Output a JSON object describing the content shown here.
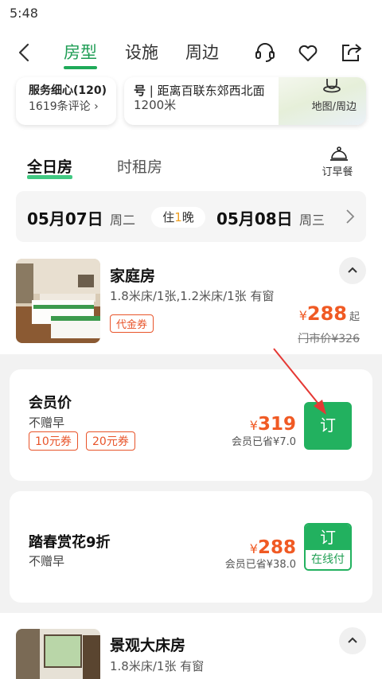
{
  "status": {
    "time": "5:48"
  },
  "nav": {
    "tabs": [
      {
        "label": "房型",
        "active": true
      },
      {
        "label": "设施",
        "active": false
      },
      {
        "label": "周边",
        "active": false
      }
    ],
    "icons": [
      "back-icon",
      "customer-service-icon",
      "heart-icon",
      "share-icon"
    ]
  },
  "info": {
    "rating_label": "服务细心(120)",
    "reviews": "1619条评论",
    "location_line1_bold": "号",
    "location_line1": "距离百联东郊西北面",
    "location_line2": "1200米",
    "map_label": "地图/周边"
  },
  "sub_tabs": [
    {
      "label": "全日房",
      "active": true
    },
    {
      "label": "时租房",
      "active": false
    }
  ],
  "breakfast_label": "订早餐",
  "dates": {
    "checkin": "05月07日",
    "checkin_weekday": "周二",
    "nights_prefix": "住",
    "nights": "1",
    "nights_suffix": "晚",
    "checkout": "05月08日",
    "checkout_weekday": "周三"
  },
  "rooms": [
    {
      "name": "家庭房",
      "beds": "1.8米床/1张,1.2米床/1张 有窗",
      "coupon": "代金券",
      "currency": "¥",
      "price": "288",
      "price_suffix": "起",
      "door_price": "门市价¥326"
    },
    {
      "name": "景观大床房",
      "beds": "1.8米床/1张 有窗"
    }
  ],
  "offers": [
    {
      "title": "会员价",
      "breakfast": "不赠早",
      "coupons": [
        "10元券",
        "20元券"
      ],
      "currency": "¥",
      "price": "319",
      "saved": "会员已省¥7.0",
      "book_label": "订"
    },
    {
      "title": "踏春赏花9折",
      "breakfast": "不赠早",
      "currency": "¥",
      "price": "288",
      "saved": "会员已省¥38.0",
      "book_label": "订",
      "pay_label": "在线付"
    }
  ],
  "colors": {
    "brand_green": "#22b15f",
    "price_orange": "#f05a24",
    "annotation_red": "#e53935"
  }
}
